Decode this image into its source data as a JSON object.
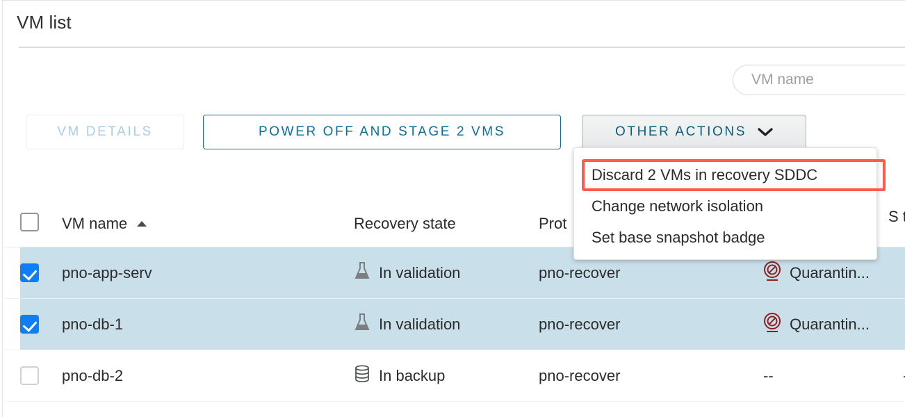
{
  "card": {
    "title": "VM list"
  },
  "search": {
    "placeholder": "VM name",
    "value": ""
  },
  "toolbar": {
    "vm_details_label": "VM DETAILS",
    "power_off_label": "POWER OFF AND STAGE 2 VMS",
    "other_actions_label": "OTHER ACTIONS"
  },
  "dropdown": {
    "items": [
      {
        "label": "Discard 2 VMs in recovery SDDC",
        "highlighted": true
      },
      {
        "label": "Change network isolation",
        "highlighted": false
      },
      {
        "label": "Set base snapshot badge",
        "highlighted": false
      }
    ]
  },
  "table": {
    "headers": {
      "vm_name": "VM name",
      "recovery_state": "Recovery state",
      "protection_group": "Prot",
      "snapshot": "S\nt"
    },
    "sort": {
      "column": "VM name",
      "direction": "ascending"
    },
    "header_checkbox_checked": false,
    "rows": [
      {
        "selected": true,
        "checked": true,
        "vm_name": "pno-app-serv",
        "recovery_state": "In validation",
        "recovery_state_icon": "flask-icon",
        "protection_group": "pno-recover",
        "snapshot_badge": "Quarantin...",
        "snapshot_badge_icon": "quarantine-ban-icon",
        "far_right": ""
      },
      {
        "selected": true,
        "checked": true,
        "vm_name": "pno-db-1",
        "recovery_state": "In validation",
        "recovery_state_icon": "flask-icon",
        "protection_group": "pno-recover",
        "snapshot_badge": "Quarantin...",
        "snapshot_badge_icon": "quarantine-ban-icon",
        "far_right": ""
      },
      {
        "selected": false,
        "checked": false,
        "vm_name": "pno-db-2",
        "recovery_state": "In backup",
        "recovery_state_icon": "database-icon",
        "protection_group": "pno-recover",
        "snapshot_badge": "--",
        "snapshot_badge_icon": "",
        "far_right": "-"
      }
    ]
  },
  "colors": {
    "link": "#0b6e96",
    "action_blue": "#0b6e96",
    "disabled_blue": "#a8cfe3",
    "selected_row": "#c9dfea",
    "checkbox_blue": "#0d7ef5",
    "annotation_red": "#fb5c4c",
    "quarantine_red": "#8b2020",
    "icon_gray": "#7a7f82"
  }
}
